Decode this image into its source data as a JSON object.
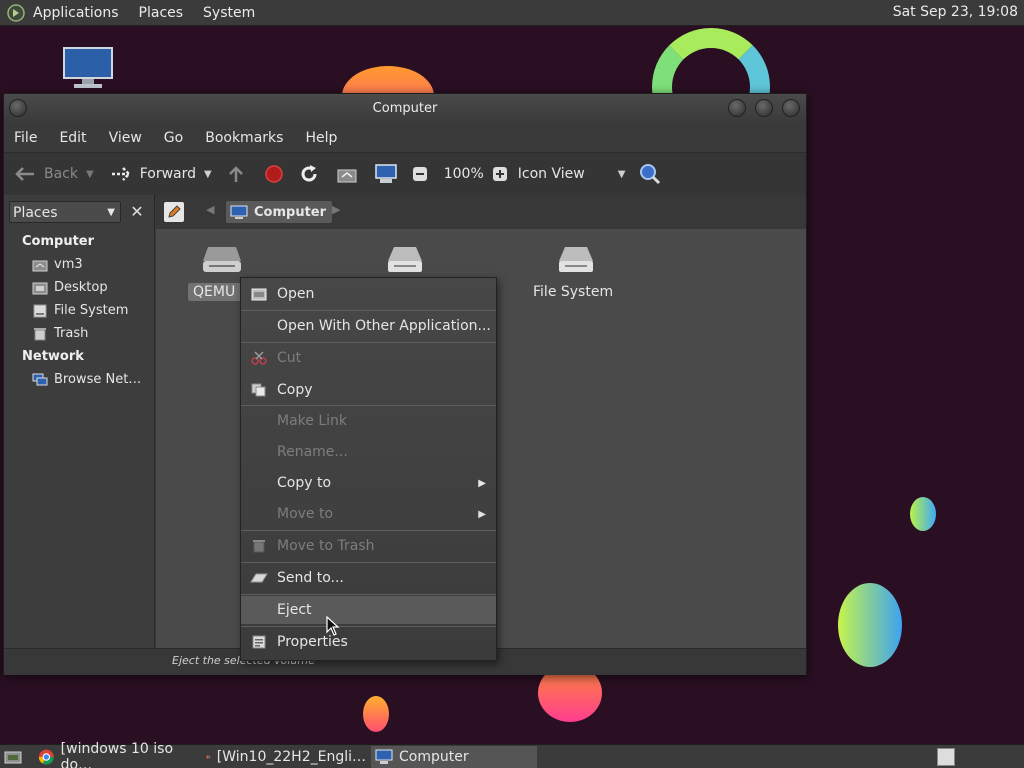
{
  "top_panel": {
    "menus": [
      "Applications",
      "Places",
      "System"
    ],
    "clock": "Sat Sep 23, 19:08"
  },
  "window": {
    "title": "Computer",
    "menubar": [
      "File",
      "Edit",
      "View",
      "Go",
      "Bookmarks",
      "Help"
    ],
    "toolbar": {
      "back": "Back",
      "forward": "Forward",
      "zoom": "100%",
      "view_mode": "Icon View"
    },
    "sidebar": {
      "selector": "Places",
      "sections": [
        {
          "heading": "Computer",
          "items": [
            "vm3",
            "Desktop",
            "File System",
            "Trash"
          ]
        },
        {
          "heading": "Network",
          "items": [
            "Browse Net…"
          ]
        }
      ]
    },
    "location": {
      "crumb": "Computer"
    },
    "drives": [
      {
        "label": "QEMU D",
        "selected": true
      },
      {
        "label": ""
      },
      {
        "label": "File System"
      }
    ],
    "status": "Eject the selected volume"
  },
  "context_menu": {
    "items": [
      {
        "label": "Open",
        "disabled": false
      },
      {
        "label": "Open With Other Application...",
        "disabled": false
      },
      {
        "label": "Cut",
        "disabled": true
      },
      {
        "label": "Copy",
        "disabled": false
      },
      {
        "label": "Make Link",
        "disabled": true
      },
      {
        "label": "Rename...",
        "disabled": true
      },
      {
        "label": "Copy to",
        "disabled": false
      },
      {
        "label": "Move to",
        "disabled": true
      },
      {
        "label": "Move to Trash",
        "disabled": true
      },
      {
        "label": "Send to...",
        "disabled": false
      },
      {
        "label": "Eject",
        "disabled": false,
        "highlighted": true
      },
      {
        "label": "Properties",
        "disabled": false
      }
    ]
  },
  "taskbar": {
    "tasks": [
      "[windows 10 iso do…",
      "[Win10_22H2_Engli…",
      "Computer"
    ]
  },
  "colors": {
    "desktop_bg": "#2a0f22",
    "panel_bg": "#3b3b3b",
    "window_bg": "#3c3c3c",
    "content_bg": "#4a4a4a"
  }
}
